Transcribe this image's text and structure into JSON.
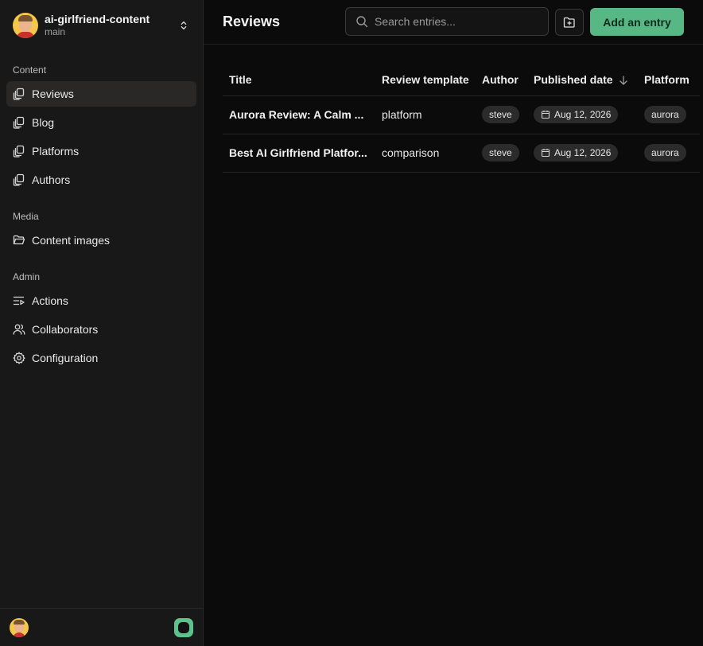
{
  "repo": {
    "name": "ai-girlfriend-content",
    "branch": "main"
  },
  "sidebar": {
    "sections": [
      {
        "label": "Content"
      },
      {
        "label": "Media"
      },
      {
        "label": "Admin"
      }
    ],
    "content_items": [
      {
        "label": "Reviews",
        "icon": "collection-icon",
        "active": true
      },
      {
        "label": "Blog",
        "icon": "collection-icon"
      },
      {
        "label": "Platforms",
        "icon": "collection-icon"
      },
      {
        "label": "Authors",
        "icon": "collection-icon"
      }
    ],
    "media_items": [
      {
        "label": "Content images",
        "icon": "folder-open-icon"
      }
    ],
    "admin_items": [
      {
        "label": "Actions",
        "icon": "actions-icon"
      },
      {
        "label": "Collaborators",
        "icon": "users-icon"
      },
      {
        "label": "Configuration",
        "icon": "gear-icon"
      }
    ]
  },
  "header": {
    "title": "Reviews",
    "search_placeholder": "Search entries...",
    "add_label": "Add an entry",
    "accent_color": "#57b886"
  },
  "table": {
    "columns": [
      "Title",
      "Review template",
      "Author",
      "Published date",
      "Platform"
    ],
    "rows": [
      {
        "title": "Aurora Review: A Calm ...",
        "template": "platform",
        "author": "steve",
        "date": "Aug 12, 2026",
        "platform": "aurora"
      },
      {
        "title": "Best AI Girlfriend Platfor...",
        "template": "comparison",
        "author": "steve",
        "date": "Aug 12, 2026",
        "platform": "aurora"
      }
    ]
  }
}
